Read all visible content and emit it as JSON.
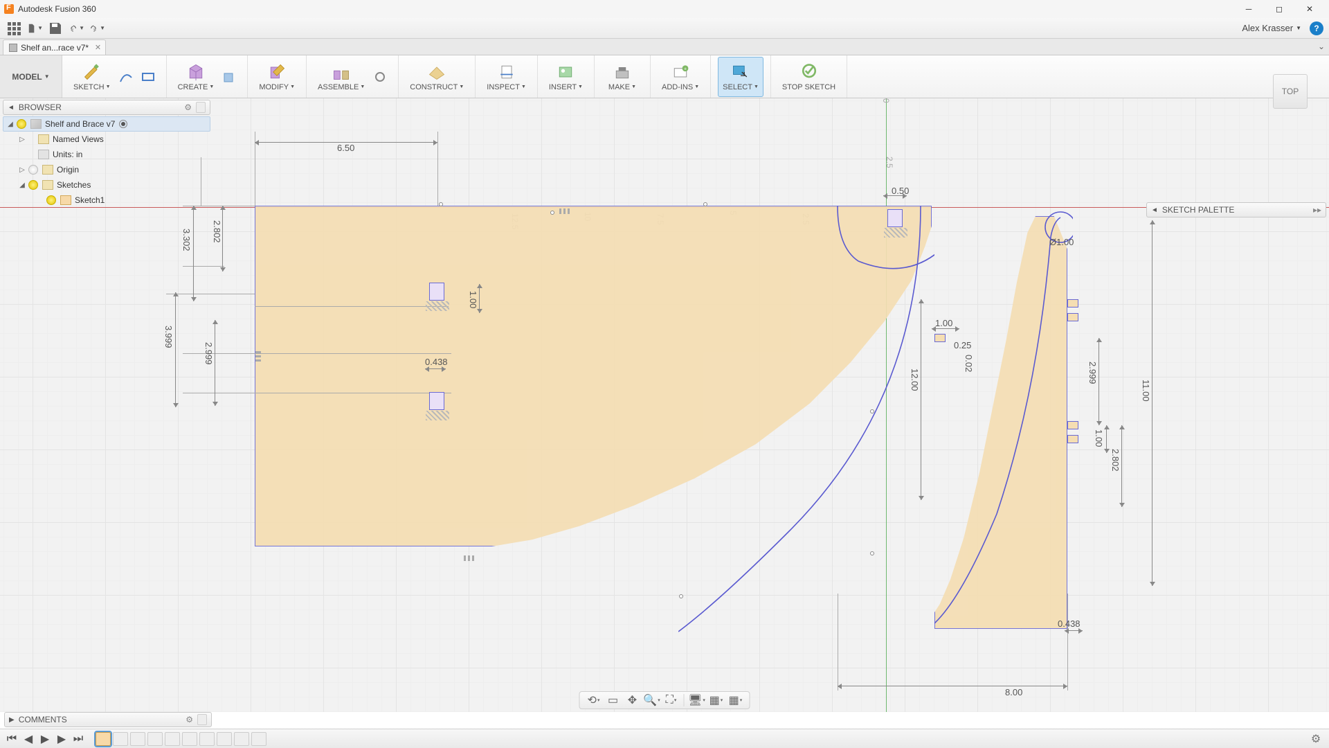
{
  "app": {
    "title": "Autodesk Fusion 360"
  },
  "qat": {
    "user": "Alex Krasser"
  },
  "tab": {
    "label": "Shelf an...race v7*"
  },
  "workspace": {
    "label": "MODEL"
  },
  "ribbon": {
    "sketch": "SKETCH",
    "create": "CREATE",
    "modify": "MODIFY",
    "assemble": "ASSEMBLE",
    "construct": "CONSTRUCT",
    "inspect": "INSPECT",
    "insert": "INSERT",
    "make": "MAKE",
    "addins": "ADD-INS",
    "select": "SELECT",
    "stop": "STOP SKETCH"
  },
  "browser": {
    "title": "BROWSER",
    "root": "Shelf and Brace v7",
    "named_views": "Named Views",
    "units": "Units: in",
    "origin": "Origin",
    "sketches": "Sketches",
    "sketch1": "Sketch1"
  },
  "palette": {
    "title": "SKETCH PALETTE"
  },
  "viewcube": {
    "face": "TOP"
  },
  "comments": {
    "title": "COMMENTS"
  },
  "dims": {
    "d_6_50": "6.50",
    "d_3_302": "3.302",
    "d_2_802a": "2.802",
    "d_3_999": "3.999",
    "d_2_999a": "2.999",
    "d_1_00a": "1.00",
    "d_0_438a": "0.438",
    "d_0_50": "0.50",
    "d_1_00b": "1.00",
    "d_12_00": "12.00",
    "d_8_00": "8.00",
    "d_11_00": "11.00",
    "d_2_999b": "2.999",
    "d_2_802b": "2.802",
    "d_1_00c": "1.00",
    "d_0_438b": "0.438",
    "d_dia_1": "Ø1.00",
    "d_0_25": "0.25",
    "d_0_02": "0.02"
  },
  "ruler": {
    "x_12_5": "12.5",
    "x_10": "10",
    "x_7_5": "7.5",
    "x_5": "5",
    "x_2_5": "2.5",
    "y_0": "0",
    "y_2_5": "2.5"
  }
}
